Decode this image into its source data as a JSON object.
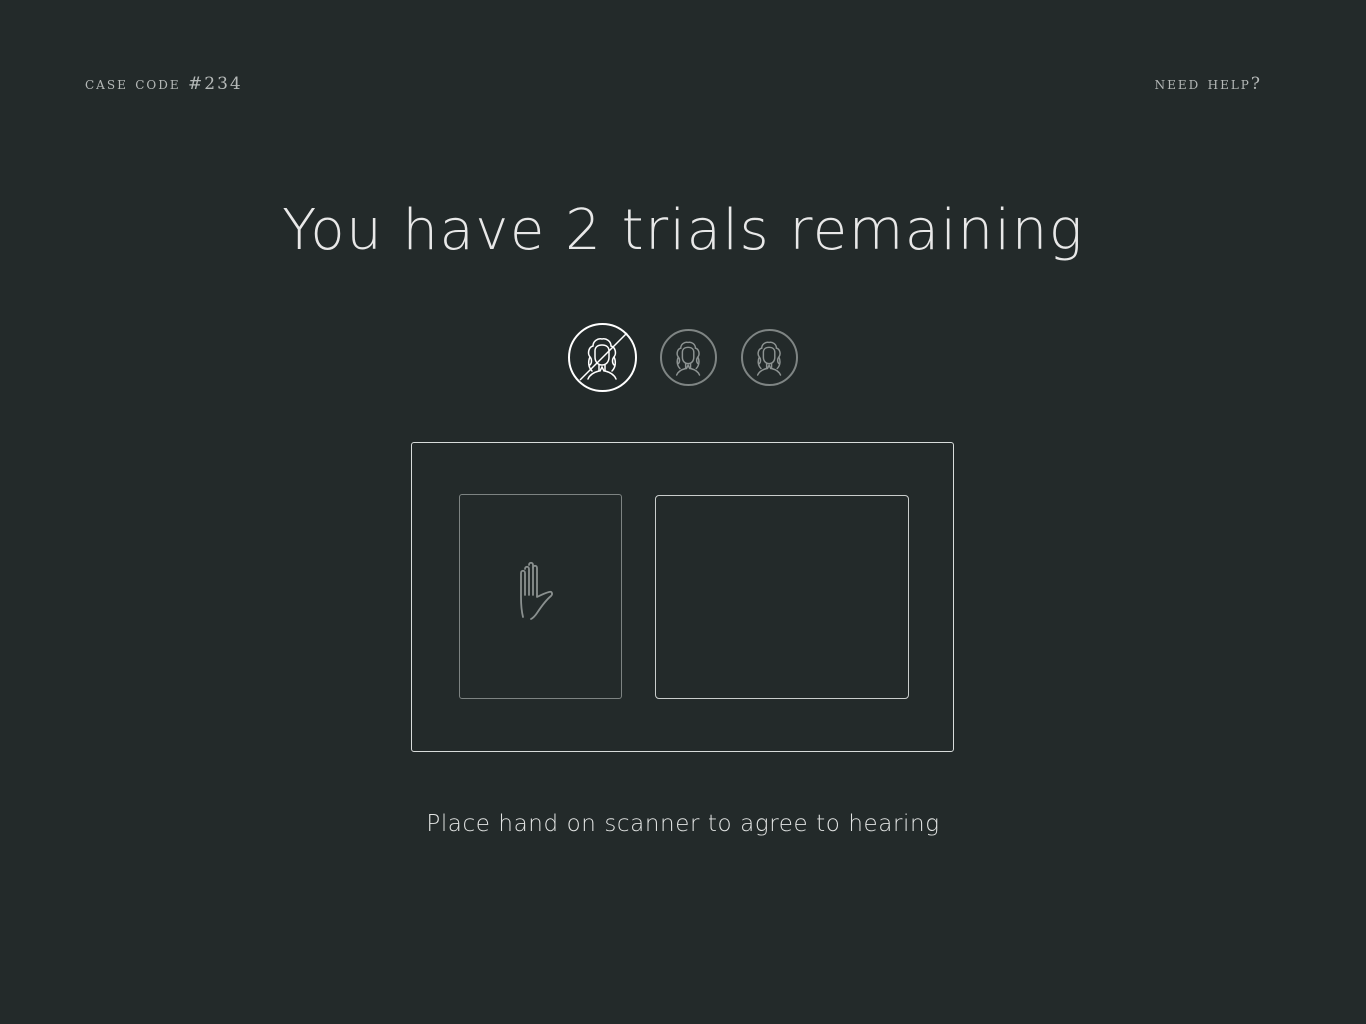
{
  "header": {
    "case_code": "case code #234",
    "help_label": "need help?"
  },
  "headline": "You have 2 trials remaining",
  "trials": {
    "total": 3,
    "used": 1,
    "icons": [
      "judge-wig-icon",
      "judge-wig-icon",
      "judge-wig-icon"
    ]
  },
  "scanner": {
    "hand_icon": "raised-hand-icon",
    "instruction": "Place hand on scanner to agree to hearing"
  },
  "colors": {
    "background": "#232a2a",
    "text": "#e6e6e6",
    "muted": "#b5b9b8",
    "used_trial_border": "#ffffff",
    "available_trial_border": "#7f8584"
  }
}
